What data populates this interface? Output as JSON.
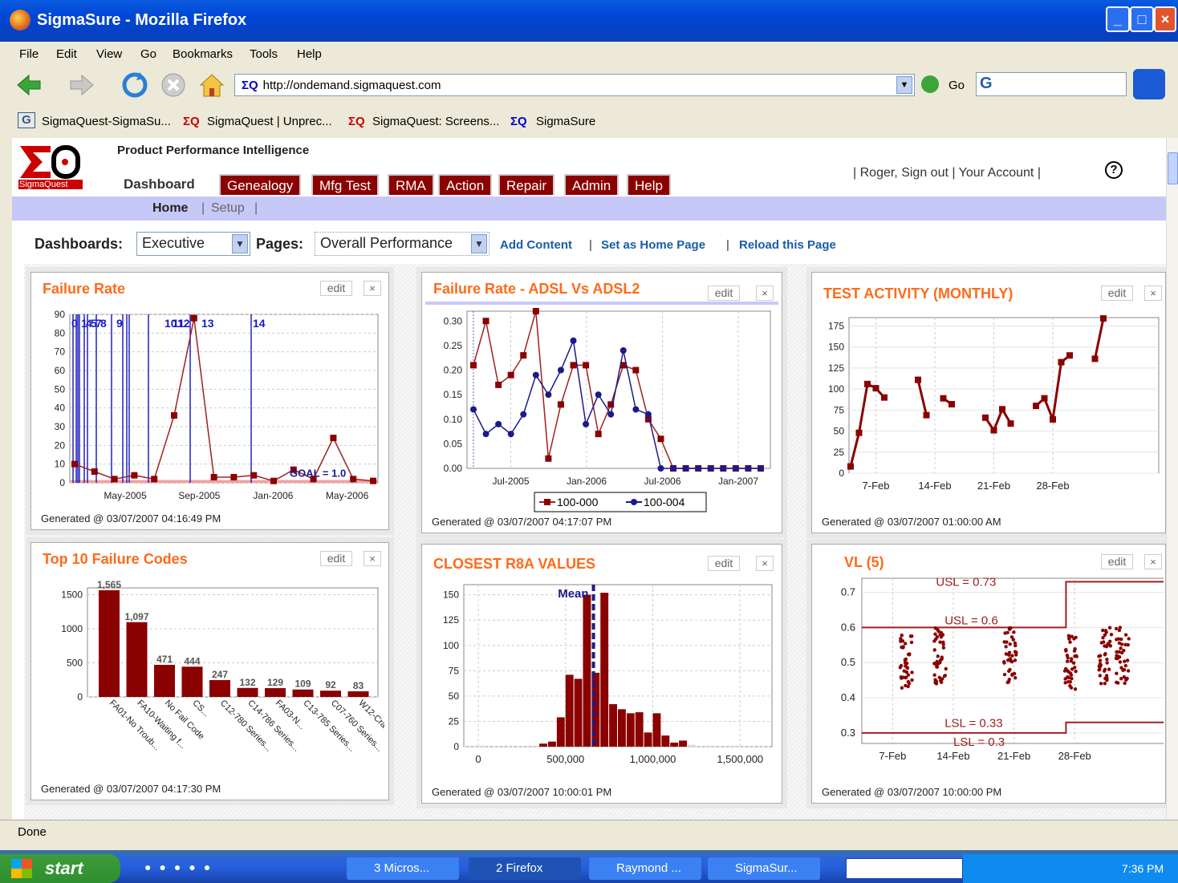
{
  "window": {
    "title": "SigmaSure - Mozilla Firefox"
  },
  "menu": [
    "File",
    "Edit",
    "View",
    "Go",
    "Bookmarks",
    "Tools",
    "Help"
  ],
  "nav": {
    "url": "http://ondemand.sigmaquest.com",
    "url_logo": "ΣQ",
    "go": "Go"
  },
  "bookmarks": [
    "SigmaQuest-SigmaSu...",
    "SigmaQuest | Unprec...",
    "SigmaQuest: Screens...",
    "SigmaSure"
  ],
  "app": {
    "tagline": "Product Performance Intelligence",
    "brand": "SigmaQuest",
    "tabs": [
      "Dashboard",
      "Genealogy",
      "Mfg Test",
      "RMA",
      "Action",
      "Repair",
      "Admin",
      "Help"
    ],
    "user_links": [
      "Roger, Sign out",
      "Your Account"
    ],
    "subnav": {
      "home": "Home",
      "setup": "Setup"
    }
  },
  "toolbar": {
    "dashboards_label": "Dashboards:",
    "dashboards_value": "Executive",
    "pages_label": "Pages:",
    "pages_value": "Overall Performance",
    "links": [
      "Add Content",
      "Set as Home Page",
      "Reload this Page"
    ]
  },
  "panels": {
    "edit": "edit",
    "close": "×",
    "fr": {
      "title": "Failure Rate",
      "generated": "Generated @ 03/07/2007 04:16:49 PM"
    },
    "adsl": {
      "title": "Failure Rate - ADSL Vs ADSL2",
      "generated": "Generated @ 03/07/2007 04:17:07 PM"
    },
    "test": {
      "title": "TEST ACTIVITY (MONTHLY)",
      "generated": "Generated @ 03/07/2007 01:00:00 AM"
    },
    "top10": {
      "title": "Top 10 Failure Codes",
      "generated": "Generated @ 03/07/2007 04:17:30 PM"
    },
    "r8a": {
      "title": "CLOSEST R8A VALUES",
      "generated": "Generated @ 03/07/2007 10:00:01 PM"
    },
    "vl": {
      "title": "VL (5)",
      "generated": "Generated @ 03/07/2007 10:00:00 PM"
    }
  },
  "status": "Done",
  "taskbar": {
    "start": "start",
    "items": [
      "3 Micros...",
      "2 Firefox",
      "Raymond ...",
      "SigmaSur..."
    ],
    "clock": "7:36 PM"
  },
  "chart_data": [
    {
      "type": "line",
      "title": "Failure Rate",
      "x": [
        "Mar-2005",
        "Apr-2005",
        "May-2005",
        "Jun-2005",
        "Jul-2005",
        "Aug-2005",
        "Sep-2005",
        "Oct-2005",
        "Nov-2005",
        "Dec-2005",
        "Jan-2006",
        "Feb-2006",
        "Mar-2006",
        "Apr-2006",
        "May-2006",
        "Jun-2006"
      ],
      "values": [
        10,
        6,
        2,
        4,
        2,
        36,
        88,
        3,
        3,
        4,
        1,
        7,
        2,
        24,
        2,
        1
      ],
      "xticks": [
        "May-2005",
        "Sep-2005",
        "Jan-2006",
        "May-2006"
      ],
      "ylim": [
        0,
        90
      ],
      "yticks": [
        0,
        10,
        20,
        30,
        40,
        50,
        60,
        70,
        80,
        90
      ],
      "goal_label": "GOAL = 1.0",
      "markers": [
        "0",
        "1",
        "4",
        "5",
        "7",
        "8",
        "9",
        "10",
        "11",
        "12",
        "13",
        "14"
      ]
    },
    {
      "type": "line",
      "title": "Failure Rate - ADSL Vs ADSL2",
      "ylim": [
        0,
        0.32
      ],
      "yticks": [
        "0.00",
        "0.05",
        "0.10",
        "0.15",
        "0.20",
        "0.25",
        "0.30"
      ],
      "xticks": [
        "Jul-2005",
        "Jan-2006",
        "Jul-2006",
        "Jan-2007"
      ],
      "series": [
        {
          "name": "100-000",
          "values": [
            0.21,
            0.3,
            0.17,
            0.19,
            0.23,
            0.32,
            0.02,
            0.13,
            0.21,
            0.21,
            0.07,
            0.13,
            0.21,
            0.2,
            0.1,
            0.06,
            0,
            0,
            0,
            0,
            0,
            0,
            0,
            0
          ]
        },
        {
          "name": "100-004",
          "values": [
            0.12,
            0.07,
            0.09,
            0.07,
            0.11,
            0.19,
            0.15,
            0.2,
            0.26,
            0.09,
            0.15,
            0.11,
            0.24,
            0.12,
            0.11,
            0,
            0,
            0,
            0,
            0,
            0,
            0,
            0,
            0
          ]
        }
      ]
    },
    {
      "type": "line",
      "title": "TEST ACTIVITY (MONTHLY)",
      "ylim": [
        0,
        185
      ],
      "yticks": [
        0,
        25,
        50,
        75,
        100,
        125,
        150,
        175
      ],
      "xticks": [
        "7-Feb",
        "14-Feb",
        "21-Feb",
        "28-Feb"
      ],
      "segments": [
        [
          [
            4,
            8
          ],
          [
            5,
            48
          ],
          [
            6,
            106
          ],
          [
            7,
            101
          ],
          [
            8,
            90
          ]
        ],
        [
          [
            12,
            111
          ],
          [
            13,
            69
          ]
        ],
        [
          [
            15,
            89
          ],
          [
            16,
            82
          ]
        ],
        [
          [
            20,
            66
          ],
          [
            21,
            51
          ],
          [
            22,
            76
          ],
          [
            23,
            59
          ]
        ],
        [
          [
            26,
            80
          ],
          [
            27,
            89
          ],
          [
            28,
            64
          ],
          [
            29,
            132
          ],
          [
            30,
            140
          ]
        ],
        [
          [
            33,
            136
          ],
          [
            34,
            184
          ]
        ]
      ]
    },
    {
      "type": "bar",
      "title": "Top 10 Failure Codes",
      "categories": [
        "FA01-No Troub...",
        "FA10-Waiting f...",
        "No Fail Code",
        "CS...",
        "C12-780 Series...",
        "C14-786 Series...",
        "FA03-N...",
        "C13-785 Series...",
        "C07-760 Series...",
        "W12-Crack"
      ],
      "values": [
        1565,
        1097,
        471,
        444,
        247,
        132,
        129,
        109,
        92,
        83
      ],
      "value_labels": [
        "1,565",
        "1,097",
        "471",
        "444",
        "247",
        "132",
        "129",
        "109",
        "92",
        "83"
      ],
      "ylim": [
        0,
        1600
      ],
      "yticks": [
        0,
        500,
        1000,
        1500
      ]
    },
    {
      "type": "bar",
      "title": "CLOSEST R8A VALUES",
      "xlim": [
        0,
        1600000
      ],
      "xticks": [
        "0",
        "500,000",
        "1,000,000",
        "1,500,000"
      ],
      "ylim": [
        0,
        160
      ],
      "yticks": [
        0,
        25,
        50,
        75,
        100,
        125,
        150
      ],
      "bins": [
        [
          0,
          1
        ],
        [
          300000,
          1
        ],
        [
          350000,
          3
        ],
        [
          400000,
          5
        ],
        [
          450000,
          29
        ],
        [
          500000,
          71
        ],
        [
          550000,
          67
        ],
        [
          600000,
          150
        ],
        [
          650000,
          73
        ],
        [
          700000,
          152
        ],
        [
          750000,
          42
        ],
        [
          800000,
          37
        ],
        [
          850000,
          33
        ],
        [
          900000,
          34
        ],
        [
          950000,
          14
        ],
        [
          1000000,
          33
        ],
        [
          1050000,
          11
        ],
        [
          1100000,
          4
        ],
        [
          1150000,
          6
        ],
        [
          1200000,
          2
        ],
        [
          1300000,
          1
        ],
        [
          1450000,
          1
        ]
      ],
      "annotation": "Mean",
      "mean": 660000
    },
    {
      "type": "scatter",
      "title": "VL (5)",
      "ylim": [
        0.27,
        0.74
      ],
      "yticks": [
        "0.3",
        "0.4",
        "0.5",
        "0.6",
        "0.7"
      ],
      "xticks": [
        "7-Feb",
        "14-Feb",
        "21-Feb",
        "28-Feb"
      ],
      "usl_labels": [
        "USL = 0.73",
        "USL = 0.6"
      ],
      "lsl_labels": [
        "LSL = 0.33",
        "LSL = 0.3"
      ]
    }
  ]
}
